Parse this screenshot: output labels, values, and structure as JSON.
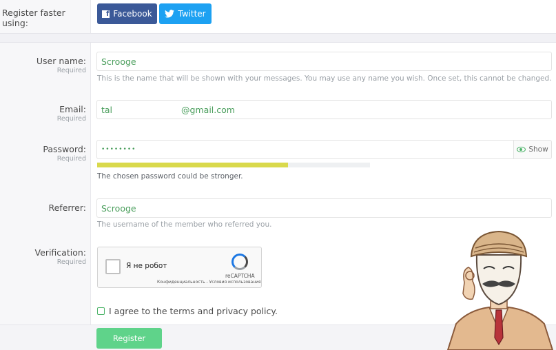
{
  "social": {
    "label": "Register faster using:",
    "facebook_label": "Facebook",
    "twitter_label": "Twitter"
  },
  "fields": {
    "username": {
      "label": "User name:",
      "required": "Required",
      "value": "Scrooge",
      "hint": "This is the name that will be shown with your messages. You may use any name you wish. Once set, this cannot be changed."
    },
    "email": {
      "label": "Email:",
      "required": "Required",
      "value_prefix": "tal",
      "value_suffix": "@gmail.com"
    },
    "password": {
      "label": "Password:",
      "required": "Required",
      "value": "••••••••",
      "show_label": "Show",
      "strength_fraction": 0.7,
      "strength_color": "#d9d94c",
      "hint": "The chosen password could be stronger."
    },
    "referrer": {
      "label": "Referrer:",
      "value": "Scrooge",
      "hint": "The username of the member who referred you."
    },
    "verification": {
      "label": "Verification:",
      "required": "Required",
      "captcha_text": "Я не робот",
      "captcha_brand": "reCAPTCHA",
      "captcha_links": "Конфиденциальность - Условия использования"
    }
  },
  "agree_text": "I agree to the terms and privacy policy.",
  "register_label": "Register",
  "colors": {
    "facebook": "#3b5998",
    "twitter": "#1da1f2",
    "accent_green": "#5fd38a",
    "value_green": "#4a9e5c"
  }
}
